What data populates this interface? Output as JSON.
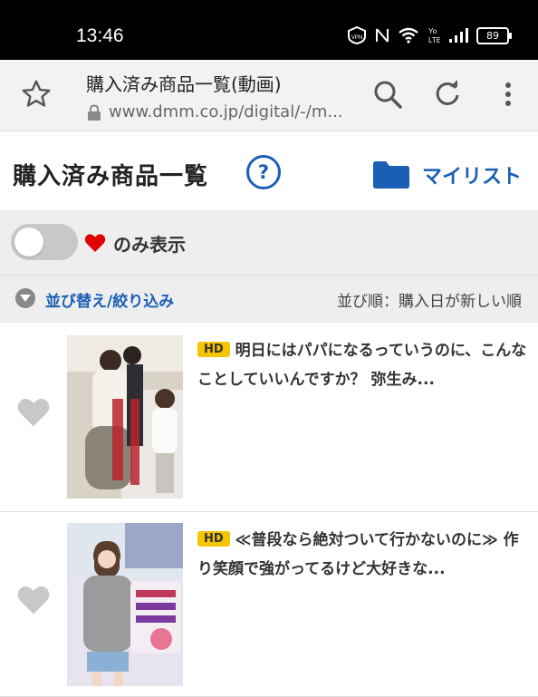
{
  "status_bar": {
    "time": "13:46",
    "icons": [
      "vpn-icon",
      "nfc-icon",
      "wifi-icon",
      "volte-icon",
      "signal-icon"
    ],
    "battery": "89"
  },
  "browser": {
    "page_title": "購入済み商品一覧(動画)",
    "url": "www.dmm.co.jp/digital/-/m..."
  },
  "header": {
    "title": "購入済み商品一覧",
    "help_symbol": "?",
    "mylist_label": "マイリスト"
  },
  "filter": {
    "favorites_only_label": "のみ表示",
    "toggle_on": false
  },
  "sort": {
    "sort_filter_label": "並び替え/絞り込み",
    "order_label": "並び順：購入日が新しい順"
  },
  "products": [
    {
      "badge": "HD",
      "title": "明日にはパパになるっていうのに、こんなことしていいんですか？ 弥生み..."
    },
    {
      "badge": "HD",
      "title": "≪普段なら絶対ついて行かないのに≫ 作り笑顔で強がってるけど大好きな..."
    }
  ],
  "colors": {
    "accent": "#1a5fb4",
    "hd_badge": "#f5c400",
    "heart_red": "#e00000",
    "heart_gray": "#c8c8c8"
  }
}
